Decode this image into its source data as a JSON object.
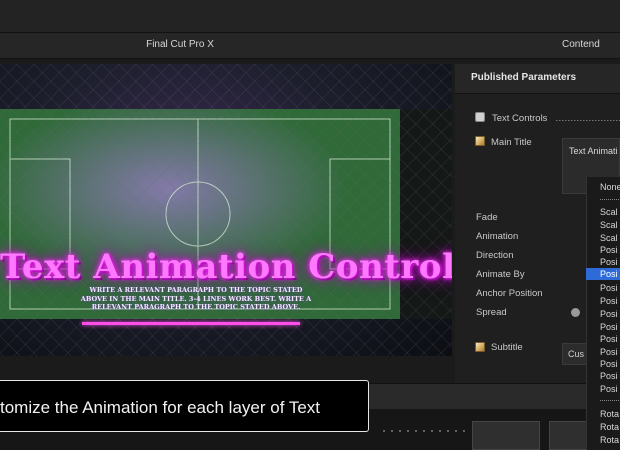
{
  "app": {
    "title": "Final Cut Pro X",
    "right_title": "Contend"
  },
  "viewer": {
    "main_title": "Text Animation Controls",
    "paragraph": "Write a relevant paragraph to the topic stated above in the main title. 3-4 lines work best. Write a relevant paragraph to the topic stated above."
  },
  "caption": "tomize the Animation for each layer of Text",
  "inspector": {
    "header": "Published Parameters",
    "text_controls": "Text Controls",
    "main_title": "Main Title",
    "params": [
      "Fade",
      "Animation",
      "Direction",
      "Animate By",
      "Anchor Position",
      "Spread"
    ],
    "subtitle": "Subtitle"
  },
  "popup": {
    "header": "Text Animati",
    "custom_button": "Cus"
  },
  "dropdown": {
    "items": [
      "None",
      "Scal",
      "Scal",
      "Scal",
      "Posi",
      "Posi",
      "Posi",
      "Posi",
      "Posi",
      "Posi",
      "Posi",
      "Posi",
      "Posi",
      "Posi",
      "Posi",
      "Posi",
      "Rota",
      "Rota",
      "Rota"
    ],
    "selected_index": 5
  },
  "colors": {
    "accent": "#2f6bd6",
    "title_glow": "#ff3dff"
  }
}
